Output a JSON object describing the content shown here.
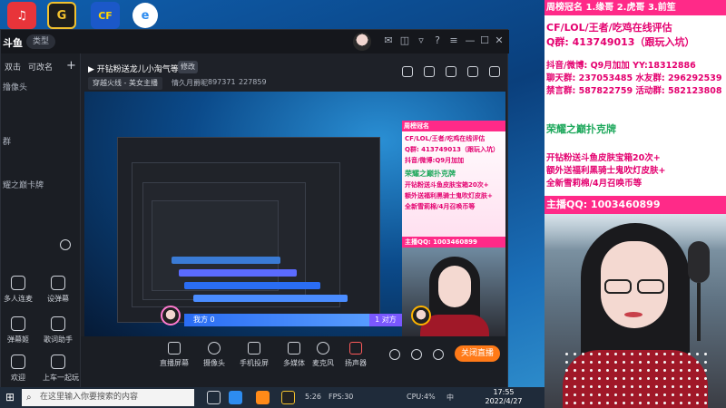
{
  "desktop": {
    "icons": [
      "网易云音乐",
      "G",
      "CF",
      "浏览器"
    ]
  },
  "studio": {
    "logo": "斗鱼",
    "type_pill": "类型",
    "sidebar": {
      "tabs": [
        "双击",
        "可改名"
      ],
      "add": "+",
      "rows": [
        "撸像头",
        "群",
        "耀之巅卡牌"
      ],
      "tools": [
        {
          "label": "多人连麦"
        },
        {
          "label": "设弹幕"
        },
        {
          "label": "弹幕姬"
        },
        {
          "label": "歌词助手"
        },
        {
          "label": "欢迎"
        },
        {
          "label": "上车一起玩"
        }
      ],
      "brand": "斗鱼",
      "brand_sub": "雪商号"
    },
    "header": {
      "room_title": "▶ 开钻粉送龙儿小淘气等",
      "edit": "修改",
      "category": "穿越火线 - 美女主播",
      "guest": "情久月爵昵",
      "room_no": "897371",
      "fans": "227859"
    },
    "preview": {
      "ad_head": "周榜冠名",
      "ad_rows": [
        "CF/LOL/王者/吃鸡在线评估",
        "Q群: 413749013（跟玩入坑）",
        "抖音/微博:Q9月加加"
      ],
      "ad_green": "荣耀之巅扑克牌",
      "ad_rows2": [
        "开钻粉送斗鱼皮肤宝箱20次+",
        "额外送福利黑骑士鬼吹灯皮肤+",
        "全新雪莉棉/4月召唤币等"
      ],
      "qq": "主播QQ: 1003460899",
      "pk_left": "我方 0",
      "pk_right": "1 对方",
      "mark_a": "1 对方"
    },
    "toolbar": {
      "items": [
        {
          "label": "直播屏幕"
        },
        {
          "label": "摄像头"
        },
        {
          "label": "手机投屏"
        },
        {
          "label": "多媒体"
        },
        {
          "label": "麦克风"
        },
        {
          "label": "扬声器"
        }
      ],
      "live_button": "关闭直播"
    }
  },
  "taskbar": {
    "search_placeholder": "在这里输入你要搜索的内容",
    "tray": [
      "5:26",
      "FPS:30",
      "CPU:4%",
      "中"
    ],
    "time": "17:55",
    "date": "2022/4/27"
  },
  "panel": {
    "header": "周榜冠名  1.缘哥  2.虎哥  3.前笙",
    "line1": "CF/LOL/王者/吃鸡在线评估",
    "line2": "Q群: 413749013（跟玩入坑）",
    "line3": "抖音/微博: Q9月加加  YY:18312886",
    "line4": "聊天群: 237053485  水友群: 296292539",
    "line5": "禁言群: 587822759  活动群: 582123808",
    "green_title": "荣耀之巅扑克牌",
    "line6": "开钻粉送斗鱼皮肤宝箱20次+",
    "line7": "额外送福利黑骑士鬼吹灯皮肤+",
    "line8": "全新雪莉棉/4月召唤币等",
    "qq": "主播QQ: 1003460899"
  },
  "colors": {
    "accent_pink": "#ff2a88",
    "text_pink": "#e4006f",
    "green": "#1ea85c",
    "live_orange": "#ff7a18"
  }
}
